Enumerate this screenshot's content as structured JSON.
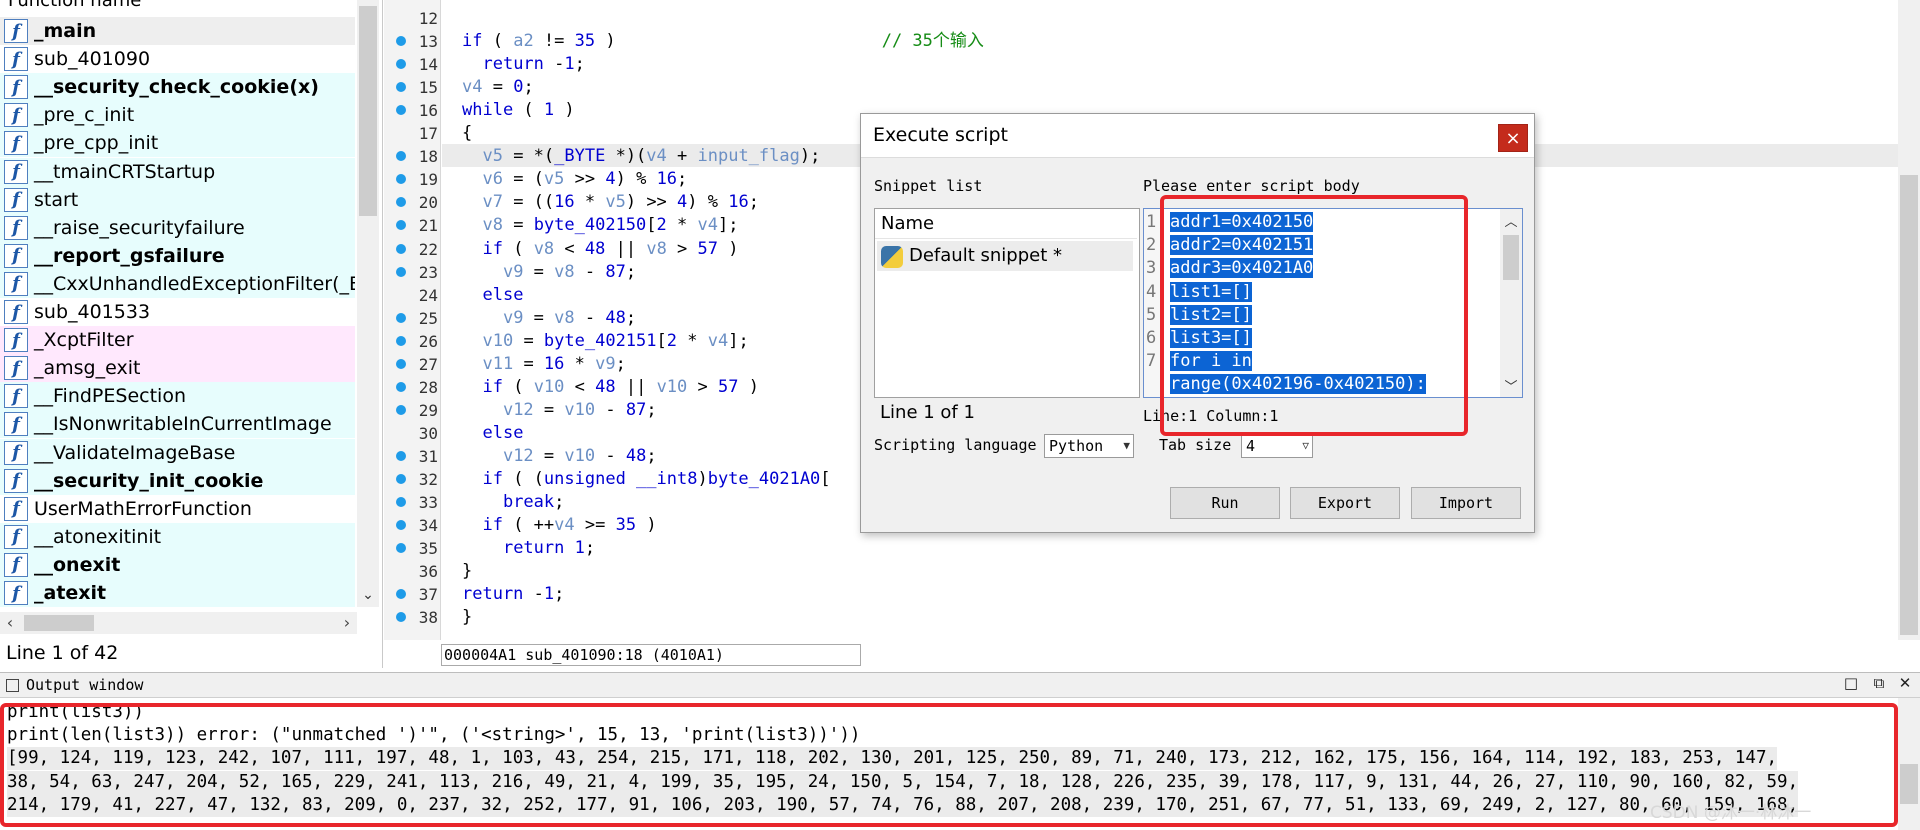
{
  "functions": {
    "header": "Function name",
    "status": "Line 1 of 42",
    "items": [
      {
        "name": "_main",
        "bg": "sel",
        "bold": true
      },
      {
        "name": "sub_401090",
        "bg": "white",
        "bold": false
      },
      {
        "name": "__security_check_cookie(x)",
        "bg": "cyan",
        "bold": true
      },
      {
        "name": "_pre_c_init",
        "bg": "cyan",
        "bold": false
      },
      {
        "name": "_pre_cpp_init",
        "bg": "cyan",
        "bold": false
      },
      {
        "name": "__tmainCRTStartup",
        "bg": "cyan",
        "bold": false
      },
      {
        "name": "start",
        "bg": "cyan",
        "bold": false
      },
      {
        "name": "__raise_securityfailure",
        "bg": "cyan",
        "bold": false
      },
      {
        "name": "__report_gsfailure",
        "bg": "cyan",
        "bold": true
      },
      {
        "name": "__CxxUnhandledExceptionFilter(_EXCEPTION_POINTERS *)",
        "bg": "cyan",
        "bold": false
      },
      {
        "name": "sub_401533",
        "bg": "white",
        "bold": false
      },
      {
        "name": "_XcptFilter",
        "bg": "pink",
        "bold": false
      },
      {
        "name": "_amsg_exit",
        "bg": "pink",
        "bold": false
      },
      {
        "name": "__FindPESection",
        "bg": "cyan",
        "bold": false
      },
      {
        "name": "__IsNonwritableInCurrentImage",
        "bg": "cyan",
        "bold": false
      },
      {
        "name": "__ValidateImageBase",
        "bg": "cyan",
        "bold": false
      },
      {
        "name": "__security_init_cookie",
        "bg": "cyan",
        "bold": true
      },
      {
        "name": "UserMathErrorFunction",
        "bg": "white",
        "bold": false
      },
      {
        "name": "__atonexitinit",
        "bg": "cyan",
        "bold": false
      },
      {
        "name": "__onexit",
        "bg": "cyan",
        "bold": true
      },
      {
        "name": "_atexit",
        "bg": "cyan",
        "bold": true
      }
    ]
  },
  "pseudocode": {
    "status": "000004A1 sub_401090:18 (4010A1)",
    "lines": [
      {
        "n": "12",
        "bp": false,
        "html": ""
      },
      {
        "n": "13",
        "bp": true,
        "html": "<span class=\"k\">if</span> ( <span class=\"v\">a2</span> != <span class=\"n\">35</span> )                          <span class=\"g\">// 35个输入</span>"
      },
      {
        "n": "14",
        "bp": true,
        "html": "  <span class=\"k\">return</span> -<span class=\"n\">1</span>;"
      },
      {
        "n": "15",
        "bp": true,
        "html": "<span class=\"v\">v4</span> = <span class=\"n\">0</span>;"
      },
      {
        "n": "16",
        "bp": true,
        "html": "<span class=\"k\">while</span> ( <span class=\"n\">1</span> )"
      },
      {
        "n": "17",
        "bp": false,
        "html": "{"
      },
      {
        "n": "18",
        "bp": true,
        "html": "  <span class=\"v\">v5</span> = *(<span class=\"k\">_BYTE</span> *)(<span class=\"v\">v4</span> + <span class=\"v\">input_flag</span>);"
      },
      {
        "n": "19",
        "bp": true,
        "html": "  <span class=\"v\">v6</span> = (<span class=\"v\">v5</span> &gt;&gt; <span class=\"n\">4</span>) % <span class=\"n\">16</span>;"
      },
      {
        "n": "20",
        "bp": true,
        "html": "  <span class=\"v\">v7</span> = ((<span class=\"n\">16</span> * <span class=\"v\">v5</span>) &gt;&gt; <span class=\"n\">4</span>) % <span class=\"n\">16</span>;"
      },
      {
        "n": "21",
        "bp": true,
        "html": "  <span class=\"v\">v8</span> = <span class=\"f\">byte_402150</span>[<span class=\"n\">2</span> * <span class=\"v\">v4</span>];"
      },
      {
        "n": "22",
        "bp": true,
        "html": "  <span class=\"k\">if</span> ( <span class=\"v\">v8</span> &lt; <span class=\"n\">48</span> || <span class=\"v\">v8</span> &gt; <span class=\"n\">57</span> )"
      },
      {
        "n": "23",
        "bp": true,
        "html": "    <span class=\"v\">v9</span> = <span class=\"v\">v8</span> - <span class=\"n\">87</span>;"
      },
      {
        "n": "24",
        "bp": false,
        "html": "  <span class=\"k\">else</span>"
      },
      {
        "n": "25",
        "bp": true,
        "html": "    <span class=\"v\">v9</span> = <span class=\"v\">v8</span> - <span class=\"n\">48</span>;"
      },
      {
        "n": "26",
        "bp": true,
        "html": "  <span class=\"v\">v10</span> = <span class=\"f\">byte_402151</span>[<span class=\"n\">2</span> * <span class=\"v\">v4</span>];"
      },
      {
        "n": "27",
        "bp": true,
        "html": "  <span class=\"v\">v11</span> = <span class=\"n\">16</span> * <span class=\"v\">v9</span>;"
      },
      {
        "n": "28",
        "bp": true,
        "html": "  <span class=\"k\">if</span> ( <span class=\"v\">v10</span> &lt; <span class=\"n\">48</span> || <span class=\"v\">v10</span> &gt; <span class=\"n\">57</span> )"
      },
      {
        "n": "29",
        "bp": true,
        "html": "    <span class=\"v\">v12</span> = <span class=\"v\">v10</span> - <span class=\"n\">87</span>;"
      },
      {
        "n": "30",
        "bp": false,
        "html": "  <span class=\"k\">else</span>"
      },
      {
        "n": "31",
        "bp": true,
        "html": "    <span class=\"v\">v12</span> = <span class=\"v\">v10</span> - <span class=\"n\">48</span>;"
      },
      {
        "n": "32",
        "bp": true,
        "html": "  <span class=\"k\">if</span> ( (<span class=\"k\">unsigned __int8</span>)<span class=\"f\">byte_4021A0</span>["
      },
      {
        "n": "33",
        "bp": true,
        "html": "    <span class=\"k\">break</span>;"
      },
      {
        "n": "34",
        "bp": true,
        "html": "  <span class=\"k\">if</span> ( ++<span class=\"v\">v4</span> &gt;= <span class=\"n\">35</span> )"
      },
      {
        "n": "35",
        "bp": true,
        "html": "    <span class=\"k\">return</span> <span class=\"n\">1</span>;"
      },
      {
        "n": "36",
        "bp": false,
        "html": "}"
      },
      {
        "n": "37",
        "bp": true,
        "html": "<span class=\"k\">return</span> -<span class=\"n\">1</span>;"
      },
      {
        "n": "38",
        "bp": true,
        "html": "}"
      }
    ]
  },
  "dialog": {
    "title": "Execute script",
    "close": "×",
    "snippet_label": "Snippet list",
    "snippet_header": "Name",
    "snippet_item": "Default snippet *",
    "snippet_status": "Line 1 of 1",
    "body_label": "Please enter script body",
    "script_lines": [
      {
        "n": "1",
        "text": "addr1=0x402150"
      },
      {
        "n": "2",
        "text": "addr2=0x402151"
      },
      {
        "n": "3",
        "text": "addr3=0x4021A0"
      },
      {
        "n": "4",
        "text": "list1=[]"
      },
      {
        "n": "5",
        "text": "list2=[]"
      },
      {
        "n": "6",
        "text": "list3=[]"
      },
      {
        "n": "7",
        "text": "for i in"
      },
      {
        "n": "",
        "text": "range(0x402196-0x402150):"
      }
    ],
    "cursor_pos": "Line:1  Column:1",
    "lang_label": "Scripting language",
    "lang_value": "Python",
    "tab_label": "Tab size",
    "tab_value": "4",
    "run": "Run",
    "export": "Export",
    "import": "Import"
  },
  "output": {
    "title": "Output window",
    "lines": [
      "print(list3))",
      "print(len(list3)) error: (\"unmatched ')'\", ('<string>', 15, 13, 'print(list3))'))",
      "[99, 124, 119, 123, 242, 107, 111, 197, 48, 1, 103, 43, 254, 215, 171, 118, 202, 130, 201, 125, 250, 89, 71, 240, 173, 212, 162, 175, 156, 164, 114, 192, 183, 253, 147,",
      "38, 54, 63, 247, 204, 52, 165, 229, 241, 113, 216, 49, 21, 4, 199, 35, 195, 24, 150, 5, 154, 7, 18, 128, 226, 235, 39, 178, 117, 9, 131, 44, 26, 27, 110, 90, 160, 82, 59,",
      "214, 179, 41, 227, 47, 132, 83, 209, 0, 237, 32, 252, 177, 91, 106, 203, 190, 57, 74, 76, 88, 207, 208, 239, 170, 251, 67, 77, 51, 133, 69, 249, 2, 127, 80, 60, 159, 168,"
    ],
    "watermark": "CSDN @沐一·林沐一"
  }
}
